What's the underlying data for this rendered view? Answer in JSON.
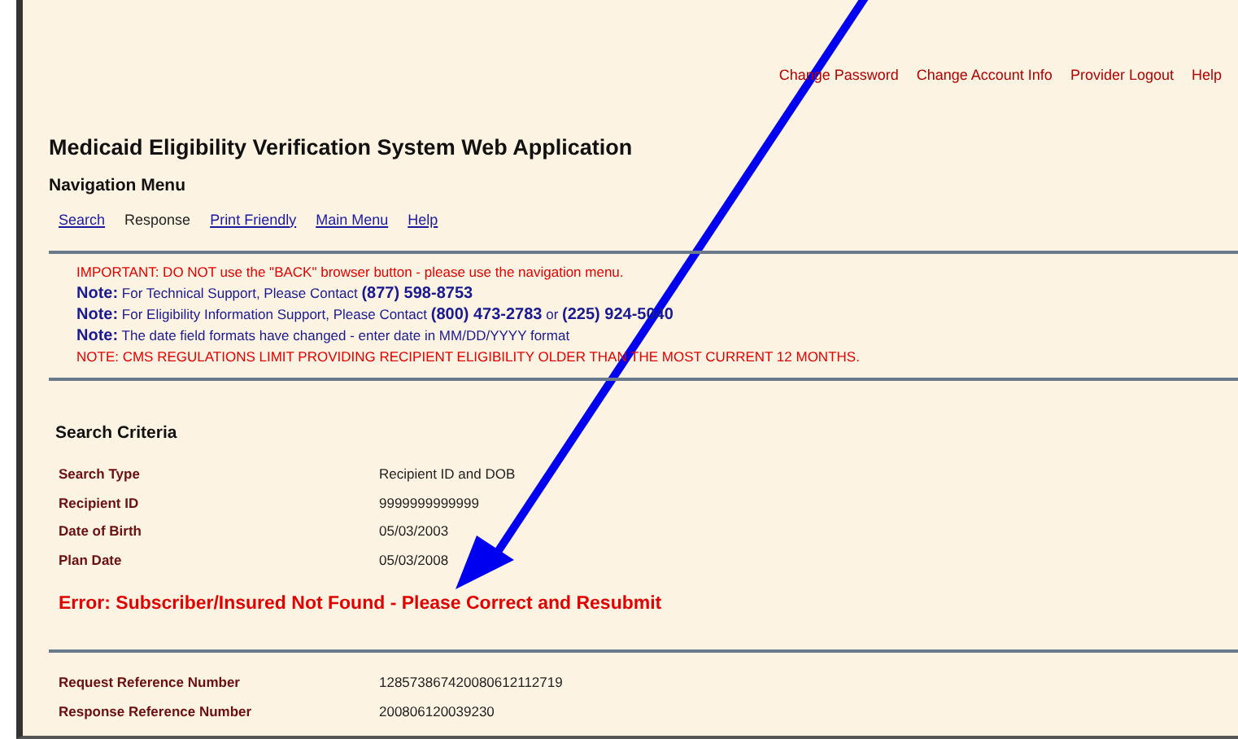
{
  "header_links": [
    "Change Password",
    "Change Account Info",
    "Provider Logout",
    "Help"
  ],
  "title": "Medicaid Eligibility Verification System Web Application",
  "navigation": {
    "heading": "Navigation Menu",
    "items": [
      {
        "label": "Search",
        "selected": false
      },
      {
        "label": "Response",
        "selected": true
      },
      {
        "label": "Print Friendly",
        "selected": false
      },
      {
        "label": "Main Menu",
        "selected": false
      },
      {
        "label": "Help",
        "selected": false
      }
    ]
  },
  "notices": [
    {
      "kind": "warning",
      "text": "IMPORTANT: DO NOT use the \"BACK\" browser button - please use the navigation menu."
    },
    {
      "kind": "note",
      "text": "**Note:** For Technical Support, Please Contact **(877) 598-8753**"
    },
    {
      "kind": "note",
      "text": "**Note:** For Eligibility Information Support, Please Contact **(800) 473-2783** or **(225) 924-5040**"
    },
    {
      "kind": "note",
      "text": "**Note:** The date field formats have changed - enter date in MM/DD/YYYY format"
    },
    {
      "kind": "warning",
      "text": "NOTE: CMS REGULATIONS LIMIT PROVIDING RECIPIENT ELIGIBILITY OLDER THAN THE MOST CURRENT 12 MONTHS."
    }
  ],
  "search_criteria": {
    "heading": "Search Criteria",
    "rows": [
      {
        "label": "Search Type",
        "value": "Recipient ID and DOB"
      },
      {
        "label": "Recipient ID",
        "value": "9999999999999"
      },
      {
        "label": "Date of Birth",
        "value": "05/03/2003"
      },
      {
        "label": "Plan Date",
        "value": "05/03/2008"
      }
    ],
    "error": "Error: Subscriber/Insured Not Found - Please Correct and Resubmit"
  },
  "references": [
    {
      "label": "Request Reference Number",
      "value": "128573867420080612112719"
    },
    {
      "label": "Response Reference Number",
      "value": "200806120039230"
    }
  ]
}
